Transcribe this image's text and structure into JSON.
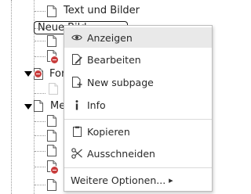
{
  "tree": {
    "nodes": [
      {
        "label": "Text und Bilder",
        "hidden": false
      },
      {
        "label": "Neue Bild",
        "hidden": false,
        "selected": true
      },
      {
        "label": "",
        "hidden": false
      },
      {
        "label": "",
        "hidden": true
      },
      {
        "label": "For",
        "hidden": true,
        "expanded": true
      },
      {
        "label": "",
        "hidden": false
      },
      {
        "label": "Me",
        "hidden": false,
        "expanded": true
      },
      {
        "label": "",
        "hidden": false
      },
      {
        "label": "",
        "hidden": false
      },
      {
        "label": "",
        "hidden": false
      },
      {
        "label": "",
        "hidden": false
      },
      {
        "label": "",
        "hidden": true
      },
      {
        "label": "",
        "hidden": false
      }
    ]
  },
  "context_menu": {
    "items": [
      {
        "label": "Anzeigen",
        "icon": "eye-icon"
      },
      {
        "label": "Bearbeiten",
        "icon": "edit-page-icon"
      },
      {
        "label": "New subpage",
        "icon": "new-page-icon"
      },
      {
        "label": "Info",
        "icon": "info-icon"
      },
      {
        "label": "Kopieren",
        "icon": "copy-icon"
      },
      {
        "label": "Ausschneiden",
        "icon": "scissors-icon"
      },
      {
        "label": "Weitere Optionen...",
        "icon": "submenu-arrow-icon"
      }
    ],
    "submenu_arrow": "▸"
  }
}
